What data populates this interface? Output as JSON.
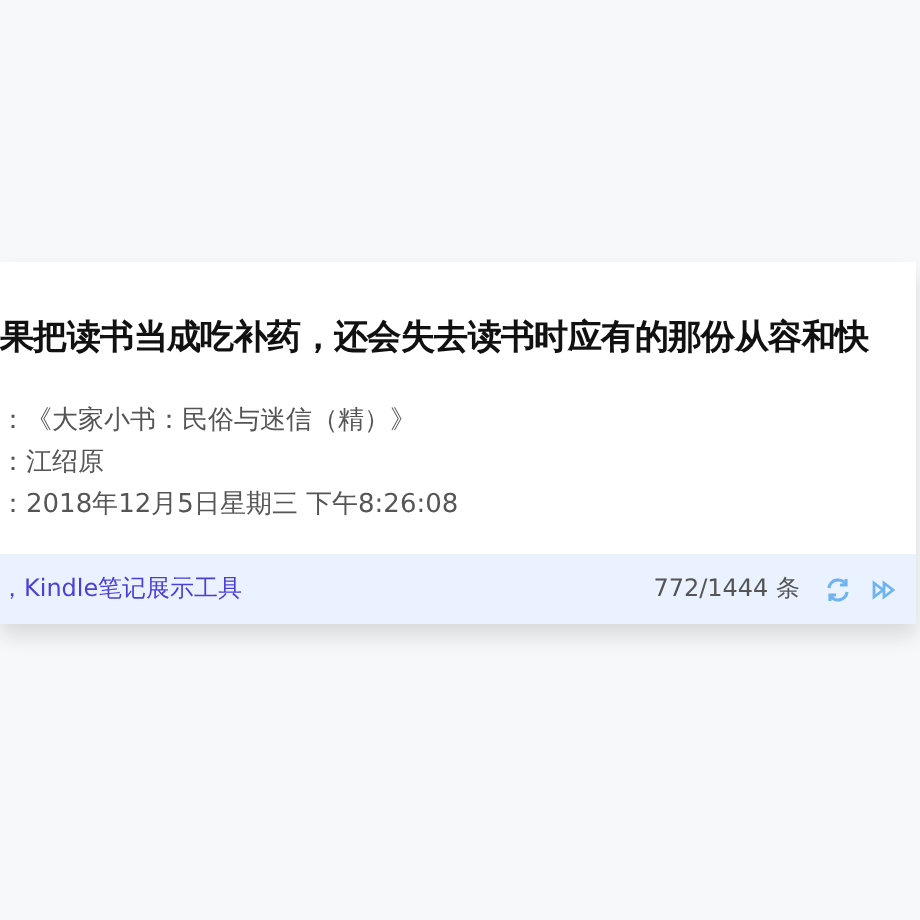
{
  "note": {
    "quote": "果把读书当成吃补药，还会失去读书时应有的那份从容和快",
    "meta": [
      "：《大家小书：民俗与迷信（精）》",
      "：江绍原",
      "：2018年12月5日星期三 下午8:26:08"
    ]
  },
  "footer": {
    "link": "，Kindle笔记展示工具",
    "count": "772/1444 条"
  }
}
